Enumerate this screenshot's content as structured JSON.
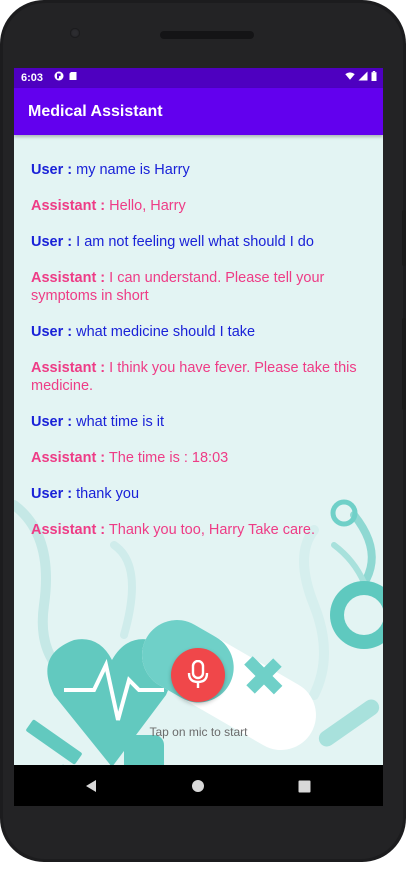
{
  "status_bar": {
    "time": "6:03",
    "icons_left": [
      "app-notification-icon",
      "sd-card-icon"
    ],
    "icons_right": [
      "wifi-icon",
      "signal-icon",
      "battery-icon"
    ]
  },
  "app_bar": {
    "title": "Medical Assistant",
    "color": "#6200ee"
  },
  "conversation": {
    "user_color": "#1a22d8",
    "assistant_color": "#ee3c86",
    "messages": [
      {
        "speaker": "User :",
        "text": "my name is Harry"
      },
      {
        "speaker": "Assistant :",
        "text": "Hello, Harry"
      },
      {
        "speaker": "User :",
        "text": "I am not feeling well what should I do"
      },
      {
        "speaker": "Assistant :",
        "text": "I can understand. Please tell your symptoms in short"
      },
      {
        "speaker": "User :",
        "text": "what medicine should I take"
      },
      {
        "speaker": "Assistant :",
        "text": "I think you have fever. Please take this medicine."
      },
      {
        "speaker": "User :",
        "text": "what time is it"
      },
      {
        "speaker": "Assistant :",
        "text": "The time is : 18:03"
      },
      {
        "speaker": "User :",
        "text": "thank you"
      },
      {
        "speaker": "Assistant :",
        "text": "Thank you too, Harry Take care."
      }
    ]
  },
  "mic": {
    "icon": "microphone-icon",
    "color": "#f0474a",
    "hint": "Tap on mic to start"
  },
  "nav_bar": {
    "icons": [
      "back-icon",
      "home-icon",
      "recents-icon"
    ]
  }
}
